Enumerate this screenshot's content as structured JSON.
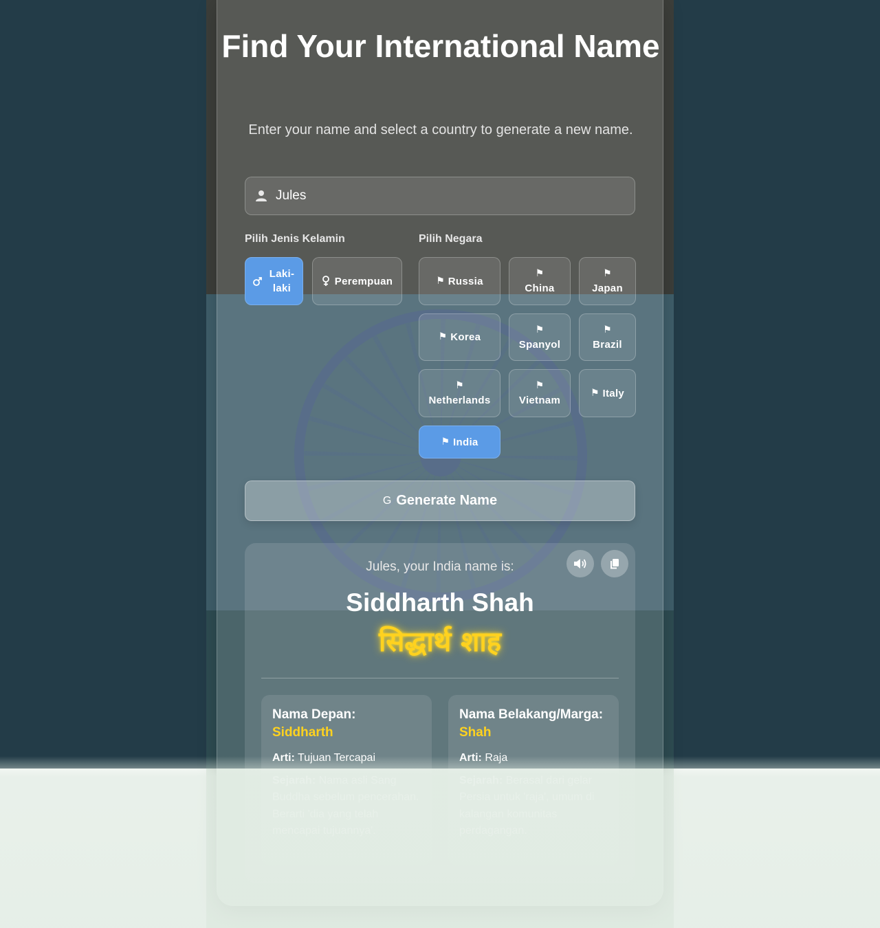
{
  "header": {
    "title": "Find Your International Name",
    "subtitle": "Enter your name and select a country to generate a new name."
  },
  "name_input": {
    "value": "Jules",
    "icon": "user-icon"
  },
  "gender": {
    "label": "Pilih Jenis Kelamin",
    "options": [
      {
        "label": "Laki-laki",
        "icon": "male-icon",
        "selected": true
      },
      {
        "label": "Perempuan",
        "icon": "female-icon",
        "selected": false
      }
    ]
  },
  "country": {
    "label": "Pilih Negara",
    "options": [
      {
        "label": "Russia",
        "selected": false
      },
      {
        "label": "China",
        "selected": false
      },
      {
        "label": "Japan",
        "selected": false
      },
      {
        "label": "Korea",
        "selected": false
      },
      {
        "label": "Spanyol",
        "selected": false
      },
      {
        "label": "Brazil",
        "selected": false
      },
      {
        "label": "Netherlands",
        "selected": false
      },
      {
        "label": "Vietnam",
        "selected": false
      },
      {
        "label": "Italy",
        "selected": false
      },
      {
        "label": "India",
        "selected": true
      }
    ]
  },
  "generate_button": {
    "icon_glyph": "G",
    "label": "Generate Name"
  },
  "result": {
    "intro": "Jules, your India name is:",
    "name": "Siddharth Shah",
    "native": "सिद्धार्थ शाह",
    "speak_icon": "speaker-icon",
    "copy_icon": "copy-icon",
    "first": {
      "heading": "Nama Depan:",
      "value": "Siddharth",
      "arti_label": "Arti:",
      "arti": "Tujuan Tercapai",
      "sejarah_label": "Sejarah:",
      "sejarah": "Nama asli Sang Buddha sebelum pencerahan. Berarti 'dia yang telah mencapai tujuannya'."
    },
    "last": {
      "heading": "Nama Belakang/Marga:",
      "value": "Shah",
      "arti_label": "Arti:",
      "arti": "Raja",
      "sejarah_label": "Sejarah:",
      "sejarah": "Berasal dari gelar Persia untuk 'raja', umum di kalangan komunitas perdagangan."
    }
  },
  "colors": {
    "accent": "#5b9be6",
    "highlight": "#ffd21f",
    "background": "#233c48"
  }
}
